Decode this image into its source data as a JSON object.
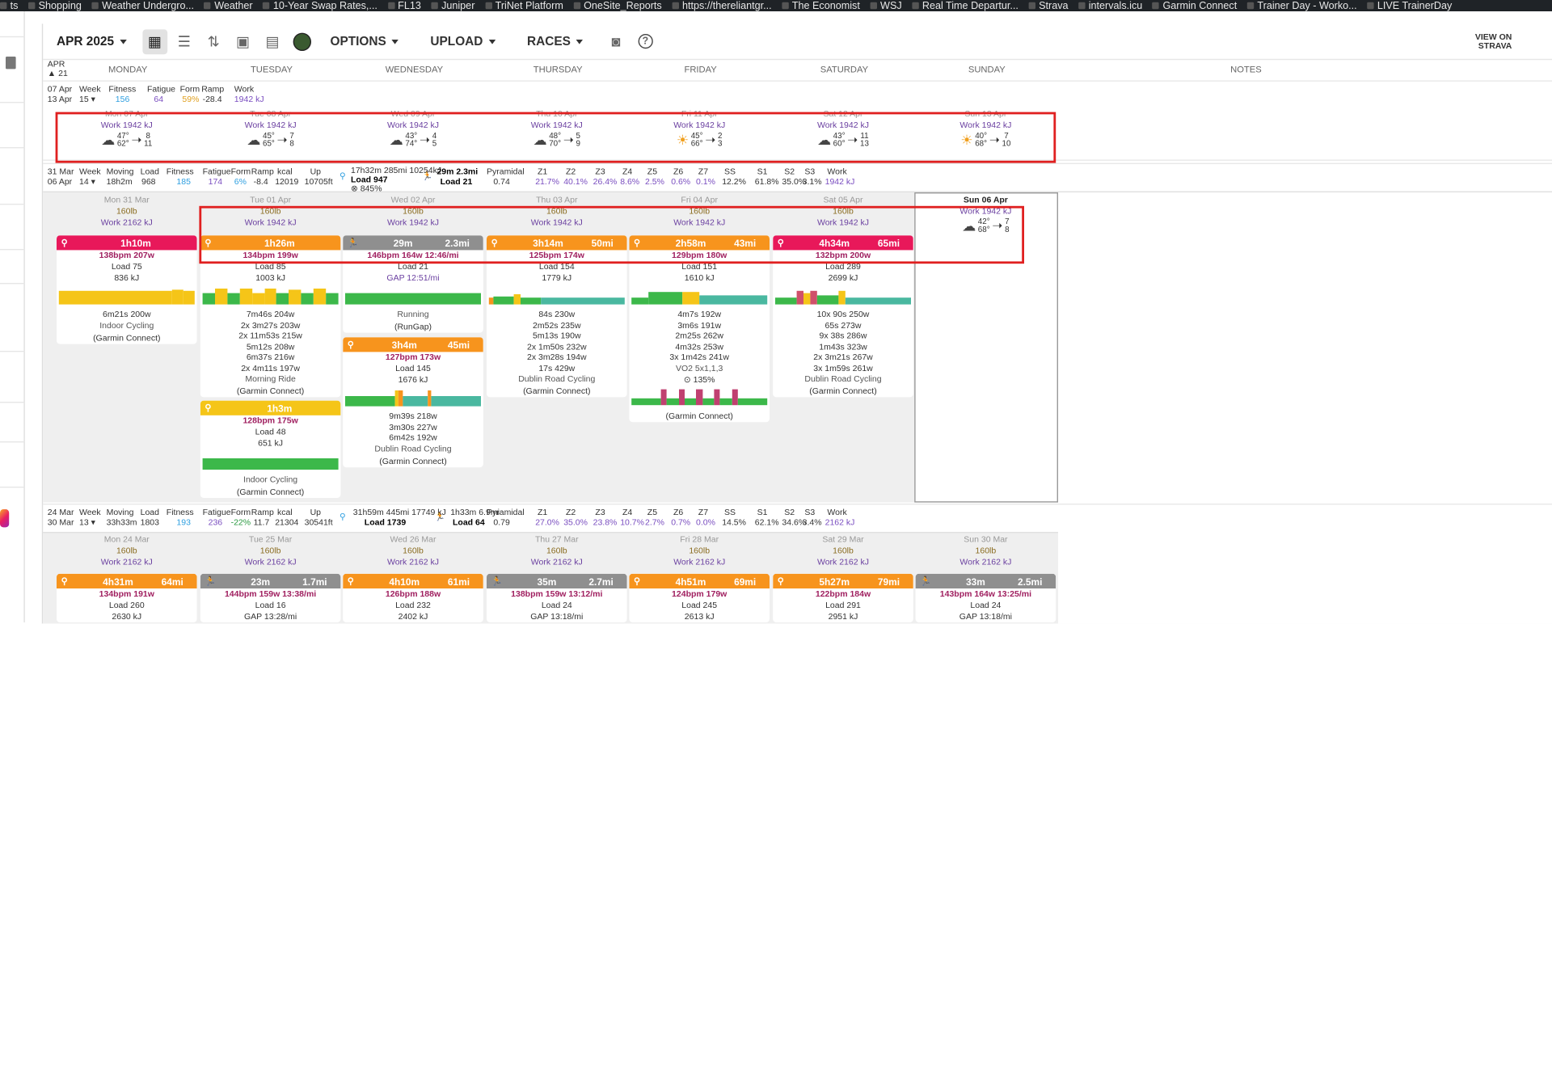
{
  "bookmarks": [
    "ts",
    "Shopping",
    "Weather Undergro...",
    "Weather",
    "10-Year Swap Rates,...",
    "FL13",
    "Juniper",
    "TriNet Platform",
    "OneSite_Reports",
    "https://thereliantgr...",
    "The Economist",
    "WSJ",
    "Real Time Departur...",
    "Strava",
    "intervals.icu",
    "Garmin Connect",
    "Trainer Day - Worko...",
    "LIVE TrainerDay"
  ],
  "toolbar": {
    "month": "APR 2025",
    "options": "OPTIONS",
    "upload": "UPLOAD",
    "races": "RACES",
    "view_on": "VIEW ON",
    "strava": "STRAVA"
  },
  "header": {
    "month_abbr": "APR",
    "day_num": "21",
    "days": [
      "MONDAY",
      "TUESDAY",
      "WEDNESDAY",
      "THURSDAY",
      "FRIDAY",
      "SATURDAY",
      "SUNDAY",
      "NOTES"
    ]
  },
  "week1": {
    "range_start": "07 Apr",
    "range_end": "13 Apr",
    "week_label": "Week",
    "week_num": "15",
    "fitness_label": "Fitness",
    "fatigue_label": "Fatigue",
    "form_label": "Form",
    "ramp_label": "Ramp",
    "work_label": "Work",
    "fitness": "156",
    "fatigue": "64",
    "form": "59%",
    "ramp": "-28.4",
    "work": "1942 kJ",
    "days": [
      {
        "date": "Mon 07 Apr",
        "work": "Work 1942 kJ",
        "hi": "47°",
        "lo": "62°",
        "w1": "8",
        "w2": "11",
        "sky": "cloud"
      },
      {
        "date": "Tue 08 Apr",
        "work": "Work 1942 kJ",
        "hi": "45°",
        "lo": "65°",
        "w1": "7",
        "w2": "8",
        "sky": "cloud"
      },
      {
        "date": "Wed 09 Apr",
        "work": "Work 1942 kJ",
        "hi": "43°",
        "lo": "74°",
        "w1": "4",
        "w2": "5",
        "sky": "cloud"
      },
      {
        "date": "Thu 10 Apr",
        "work": "Work 1942 kJ",
        "hi": "48°",
        "lo": "70°",
        "w1": "5",
        "w2": "9",
        "sky": "cloud"
      },
      {
        "date": "Fri 11 Apr",
        "work": "Work 1942 kJ",
        "hi": "45°",
        "lo": "66°",
        "w1": "2",
        "w2": "3",
        "sky": "sun"
      },
      {
        "date": "Sat 12 Apr",
        "work": "Work 1942 kJ",
        "hi": "43°",
        "lo": "60°",
        "w1": "11",
        "w2": "13",
        "sky": "cloud"
      },
      {
        "date": "Sun 13 Apr",
        "work": "Work 1942 kJ",
        "hi": "40°",
        "lo": "68°",
        "w1": "7",
        "w2": "10",
        "sky": "sun"
      }
    ]
  },
  "week2": {
    "range_start": "31 Mar",
    "range_end": "06 Apr",
    "week_label": "Week",
    "week_num": "14",
    "moving_label": "Moving",
    "load_label": "Load",
    "kcal_label": "kcal",
    "up_label": "Up",
    "fitness_label": "Fitness",
    "fatigue_label": "Fatigue",
    "form_label": "Form",
    "ramp_label": "Ramp",
    "moving": "18h2m",
    "load": "968",
    "fitness": "185",
    "fatigue": "174",
    "form": "6%",
    "ramp": "-8.4",
    "kcal": "12019",
    "up": "10705ft",
    "bike_summary": "17h32m 285mi 10254kJ",
    "bike_load": "Load 947",
    "bike_pct": "845%",
    "run_summary": "29m 2.3mi",
    "run_load": "Load 21",
    "zones_labels": [
      "Pyramidal",
      "Z1",
      "Z2",
      "Z3",
      "Z4",
      "Z5",
      "Z6",
      "Z7",
      "SS",
      "S1",
      "S2",
      "S3",
      "Work"
    ],
    "zones_values": [
      "0.74",
      "21.7%",
      "40.1%",
      "26.4%",
      "8.6%",
      "2.5%",
      "0.6%",
      "0.1%",
      "12.2%",
      "61.8%",
      "35.0%",
      "3.1%",
      "1942 kJ"
    ],
    "days": [
      {
        "date": "Mon 31 Mar",
        "weight": "160lb",
        "work": "Work 2162 kJ"
      },
      {
        "date": "Tue 01 Apr",
        "weight": "160lb",
        "work": "Work 1942 kJ"
      },
      {
        "date": "Wed 02 Apr",
        "weight": "160lb",
        "work": "Work 1942 kJ"
      },
      {
        "date": "Thu 03 Apr",
        "weight": "160lb",
        "work": "Work 1942 kJ"
      },
      {
        "date": "Fri 04 Apr",
        "weight": "160lb",
        "work": "Work 1942 kJ"
      },
      {
        "date": "Sat 05 Apr",
        "weight": "160lb",
        "work": "Work 1942 kJ"
      },
      {
        "date": "Sun 06 Apr",
        "work": "Work 1942 kJ",
        "hi": "42°",
        "lo": "68°",
        "w1": "7",
        "w2": "8"
      }
    ],
    "activities": {
      "mon": {
        "time": "1h10m",
        "hr": "138bpm 207w",
        "load": "Load 75",
        "kj": "836 kJ",
        "p1": "6m21s 200w",
        "name": "Indoor Cycling",
        "src": "(Garmin Connect)"
      },
      "tue1": {
        "time": "1h26m",
        "hr": "134bpm 199w",
        "load": "Load 85",
        "kj": "1003 kJ",
        "pw": [
          "7m46s 204w",
          "2x  3m27s 203w",
          "2x 11m53s 215w",
          "5m12s 208w",
          "6m37s 216w",
          "2x  4m11s 197w"
        ],
        "name": "Morning Ride",
        "src": "(Garmin Connect)"
      },
      "tue2": {
        "time": "1h3m",
        "hr": "128bpm 175w",
        "load": "Load 48",
        "kj": "651 kJ",
        "name": "Indoor Cycling",
        "src": "(Garmin Connect)"
      },
      "wed1": {
        "time": "29m",
        "dist": "2.3mi",
        "hr": "146bpm 164w 12:46/mi",
        "load": "Load 21",
        "gap": "GAP 12:51/mi",
        "name": "Running",
        "src": "(RunGap)"
      },
      "wed2": {
        "time": "3h4m",
        "dist": "45mi",
        "hr": "127bpm 173w",
        "load": "Load 145",
        "kj": "1676 kJ",
        "pw": [
          "9m39s 218w",
          "3m30s 227w",
          "6m42s 192w"
        ],
        "name": "Dublin Road Cycling",
        "src": "(Garmin Connect)"
      },
      "thu": {
        "time": "3h14m",
        "dist": "50mi",
        "hr": "125bpm 174w",
        "load": "Load 154",
        "kj": "1779 kJ",
        "pw": [
          "84s 230w",
          "2m52s 235w",
          "5m13s 190w",
          "2x 1m50s 232w",
          "2x 3m28s 194w",
          "17s 429w"
        ],
        "name": "Dublin Road Cycling",
        "src": "(Garmin Connect)"
      },
      "fri": {
        "time": "2h58m",
        "dist": "43mi",
        "hr": "129bpm 180w",
        "load": "Load 151",
        "kj": "1610 kJ",
        "pw": [
          "4m7s 192w",
          "3m6s 191w",
          "2m25s 262w",
          "4m32s 253w",
          "3x 1m42s 241w"
        ],
        "name": "VO2 5x1,1,3",
        "src": "(Garmin Connect)",
        "pct": "135%"
      },
      "sat": {
        "time": "4h34m",
        "dist": "65mi",
        "hr": "132bpm 200w",
        "load": "Load 289",
        "kj": "2699 kJ",
        "pw": [
          "10x    90s 250w",
          "65s 273w",
          "9x    38s 286w",
          "1m43s 323w",
          "2x 3m21s 267w",
          "3x 1m59s 261w"
        ],
        "name": "Dublin Road Cycling",
        "src": "(Garmin Connect)"
      }
    }
  },
  "week3": {
    "range_start": "24 Mar",
    "range_end": "30 Mar",
    "week_label": "Week",
    "week_num": "13",
    "moving": "33h33m",
    "load": "1803",
    "fitness": "193",
    "fatigue": "236",
    "form": "-22%",
    "ramp": "11.7",
    "kcal": "21304",
    "up": "30541ft",
    "bike_summary": "31h59m 445mi 17749 kJ",
    "bike_load": "Load 1739",
    "run_summary": "1h33m 6.9mi",
    "run_load": "Load 64",
    "zones_values": [
      "0.79",
      "27.0%",
      "35.0%",
      "23.8%",
      "10.7%",
      "2.7%",
      "0.7%",
      "0.0%",
      "14.5%",
      "62.1%",
      "34.6%",
      "3.4%",
      "2162 kJ"
    ],
    "days": [
      {
        "date": "Mon 24 Mar",
        "weight": "160lb",
        "work": "Work 2162 kJ",
        "time": "4h31m",
        "dist": "64mi",
        "hr": "134bpm 191w",
        "load": "Load 260",
        "kj": "2630 kJ",
        "type": "bike"
      },
      {
        "date": "Tue 25 Mar",
        "weight": "160lb",
        "work": "Work 2162 kJ",
        "time": "23m",
        "dist": "1.7mi",
        "hr": "144bpm 159w 13:38/mi",
        "load": "Load 16",
        "kj": "GAP 13:28/mi",
        "type": "run"
      },
      {
        "date": "Wed 26 Mar",
        "weight": "160lb",
        "work": "Work 2162 kJ",
        "time": "4h10m",
        "dist": "61mi",
        "hr": "126bpm 188w",
        "load": "Load 232",
        "kj": "2402 kJ",
        "type": "bike"
      },
      {
        "date": "Thu 27 Mar",
        "weight": "160lb",
        "work": "Work 2162 kJ",
        "time": "35m",
        "dist": "2.7mi",
        "hr": "138bpm 159w 13:12/mi",
        "load": "Load 24",
        "kj": "GAP 13:18/mi",
        "type": "run"
      },
      {
        "date": "Fri 28 Mar",
        "weight": "160lb",
        "work": "Work 2162 kJ",
        "time": "4h51m",
        "dist": "69mi",
        "hr": "124bpm 179w",
        "load": "Load 245",
        "kj": "2613 kJ",
        "type": "bike"
      },
      {
        "date": "Sat 29 Mar",
        "weight": "160lb",
        "work": "Work 2162 kJ",
        "time": "5h27m",
        "dist": "79mi",
        "hr": "122bpm 184w",
        "load": "Load 291",
        "kj": "2951 kJ",
        "type": "bike"
      },
      {
        "date": "Sun 30 Mar",
        "weight": "160lb",
        "work": "Work 2162 kJ",
        "time": "33m",
        "dist": "2.5mi",
        "hr": "143bpm 164w 13:25/mi",
        "load": "Load 24",
        "kj": "GAP 13:18/mi",
        "type": "run"
      }
    ]
  },
  "colors": {
    "pink": "#e8185a",
    "orange": "#f7941d",
    "yellow": "#f5c518",
    "gray": "#8f8f8f",
    "fitness": "#2f9fe0",
    "fatigue": "#7a4ec0",
    "form": "#e0a020",
    "green": "#3cb84a",
    "teal": "#4ab8a0"
  }
}
